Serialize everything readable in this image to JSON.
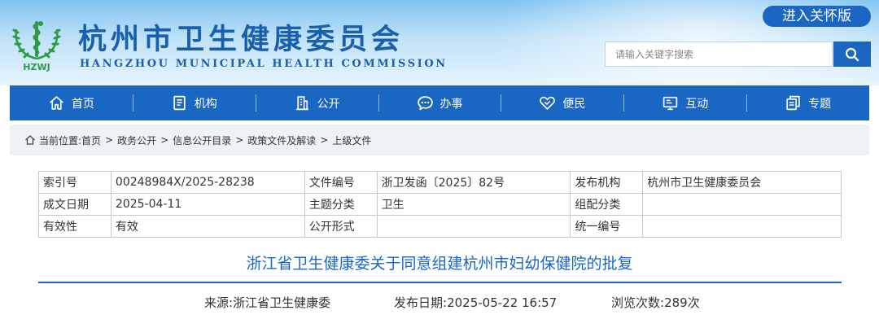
{
  "header": {
    "logo_text": "HZWJ",
    "title": "杭州市卫生健康委员会",
    "subtitle": "HANGZHOU MUNICIPAL HEALTH COMMISSION",
    "care_button": "进入关怀版",
    "search": {
      "placeholder": "请输入关键字搜索"
    }
  },
  "nav": {
    "items": [
      {
        "label": "首页",
        "icon": "home-icon"
      },
      {
        "label": "机构",
        "icon": "document-icon"
      },
      {
        "label": "公开",
        "icon": "building-icon"
      },
      {
        "label": "办事",
        "icon": "chat-icon"
      },
      {
        "label": "便民",
        "icon": "handshake-icon"
      },
      {
        "label": "互动",
        "icon": "monitor-icon"
      },
      {
        "label": "专题",
        "icon": "copy-icon"
      }
    ]
  },
  "breadcrumb": {
    "prefix": "当前位置:",
    "items": [
      "首页",
      "政务公开",
      "信息公开目录",
      "政策文件及解读",
      "上级文件"
    ],
    "separator": ">"
  },
  "meta_table": {
    "rows": [
      [
        "索引号",
        "00248984X/2025-28238",
        "文件编号",
        "浙卫发函〔2025〕82号",
        "发布机构",
        "杭州市卫生健康委员会"
      ],
      [
        "成文日期",
        "2025-04-11",
        "主题分类",
        "卫生",
        "组配分类",
        ""
      ],
      [
        "有效性",
        "有效",
        "公开形式",
        "",
        "统一编号",
        ""
      ]
    ]
  },
  "article": {
    "title": "浙江省卫生健康委关于同意组建杭州市妇幼保健院的批复",
    "source_label": "来源:",
    "source": "浙江省卫生健康委",
    "date_label": "发布日期:",
    "date": "2025-05-22 16:57",
    "views_label": "浏览次数:",
    "views": "289次"
  },
  "colors": {
    "brand_blue": "#1a66c3",
    "title_blue": "#1a5fae",
    "logo_green": "#2e9a45"
  }
}
